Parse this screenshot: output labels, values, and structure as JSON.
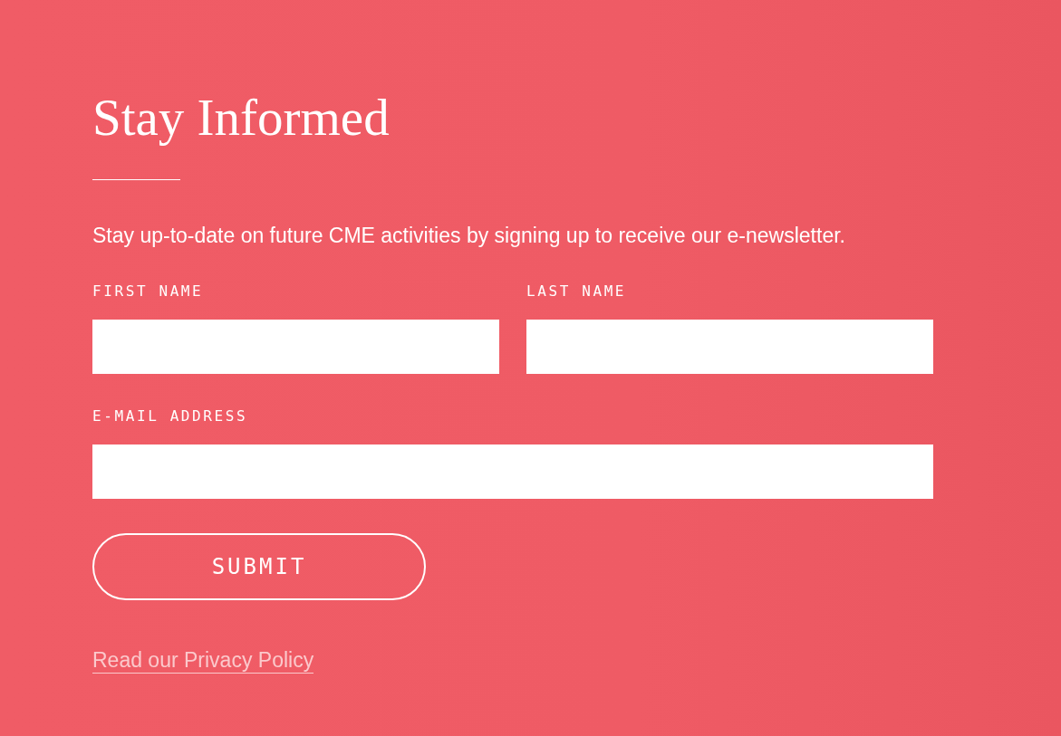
{
  "title": "Stay Informed",
  "description": "Stay up-to-date on future CME activities by signing up to receive our e-newsletter.",
  "field_rows": [
    {
      "fields": [
        {
          "label": "FIRST NAME"
        },
        {
          "label": "LAST NAME"
        }
      ]
    },
    {
      "fields": [
        {
          "label": "E-MAIL ADDRESS"
        }
      ]
    }
  ],
  "submit_button": "SUBMIT",
  "privacy_link": "Read our Privacy Policy"
}
